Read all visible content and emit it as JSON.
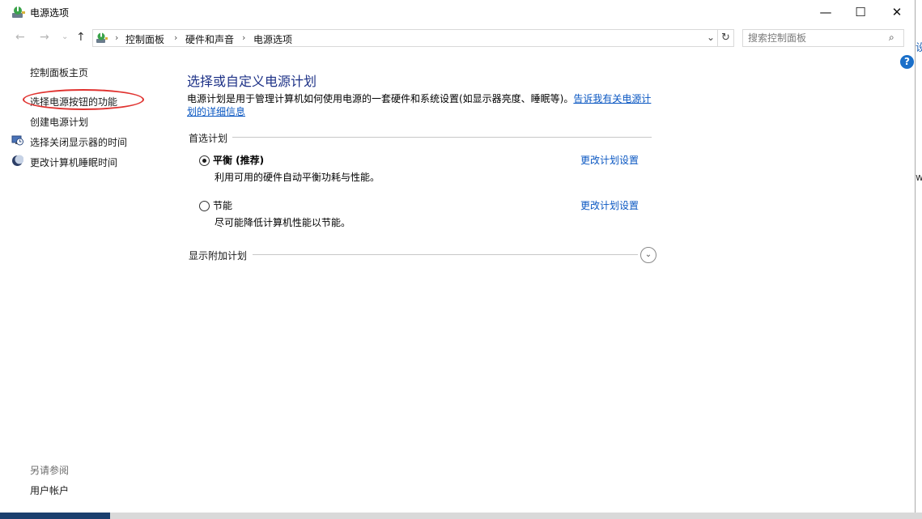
{
  "window": {
    "title": "电源选项",
    "minimize": "—",
    "maximize": "☐",
    "close": "✕"
  },
  "nav": {
    "back": "←",
    "forward": "→",
    "recent": "⌄",
    "up": "↑"
  },
  "address": {
    "crumbs": [
      "控制面板",
      "硬件和声音",
      "电源选项"
    ],
    "separator": "›",
    "dropdown": "⌄",
    "refresh": "↻"
  },
  "search": {
    "placeholder": "搜索控制面板",
    "icon": "⌕"
  },
  "help": "?",
  "sidebar": {
    "items": [
      {
        "label": "控制面板主页",
        "icon": ""
      },
      {
        "label": "选择电源按钮的功能",
        "icon": ""
      },
      {
        "label": "创建电源计划",
        "icon": ""
      },
      {
        "label": "选择关闭显示器的时间",
        "icon": "monitor-clock-icon"
      },
      {
        "label": "更改计算机睡眠时间",
        "icon": "moon-icon"
      }
    ],
    "see_also_title": "另请参阅",
    "see_also_items": [
      "用户帐户"
    ]
  },
  "main": {
    "title": "选择或自定义电源计划",
    "description": "电源计划是用于管理计算机如何使用电源的一套硬件和系统设置(如显示器亮度、睡眠等)。",
    "description_link_1": "告诉我有关电源计",
    "description_link_2": "划的详细信息",
    "preferred_section": "首选计划",
    "plans": [
      {
        "name": "平衡 (推荐)",
        "desc": "利用可用的硬件自动平衡功耗与性能。",
        "link": "更改计划设置",
        "selected": true
      },
      {
        "name": "节能",
        "desc": "尽可能降低计算机性能以节能。",
        "link": "更改计划设置",
        "selected": false
      }
    ],
    "additional_section": "显示附加计划",
    "expand_icon": "⌄"
  },
  "desktop_fragments": {
    "right_top": "设",
    "right_mid": "w"
  },
  "colors": {
    "accent": "#1e3287",
    "link": "#0a57c2",
    "highlight": "#e0322f"
  }
}
